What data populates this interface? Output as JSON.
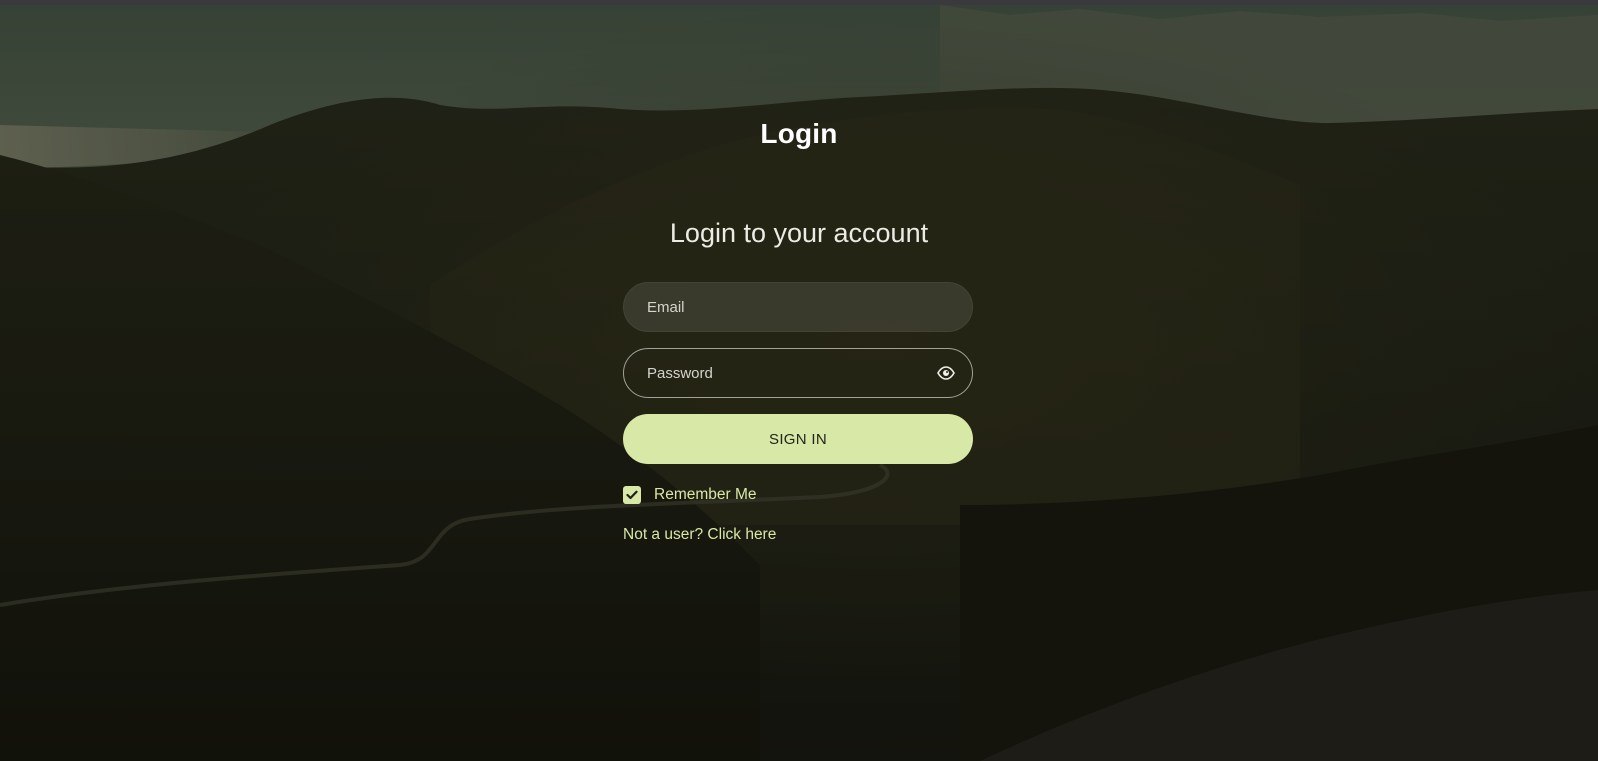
{
  "page": {
    "title": "Login",
    "subtitle": "Login to your account"
  },
  "form": {
    "email": {
      "value": "",
      "placeholder": "Email"
    },
    "password": {
      "value": "",
      "placeholder": "Password",
      "toggle_icon": "eye-icon"
    },
    "submit_label": "SIGN IN",
    "remember_me": {
      "label": "Remember Me",
      "checked": true
    },
    "signup_link": "Not a user? Click here"
  },
  "colors": {
    "accent": "#d8e8a6",
    "title_text": "#ffffff",
    "button_text": "#23251c"
  },
  "background": {
    "description": "dark mountain landscape at dusk"
  }
}
